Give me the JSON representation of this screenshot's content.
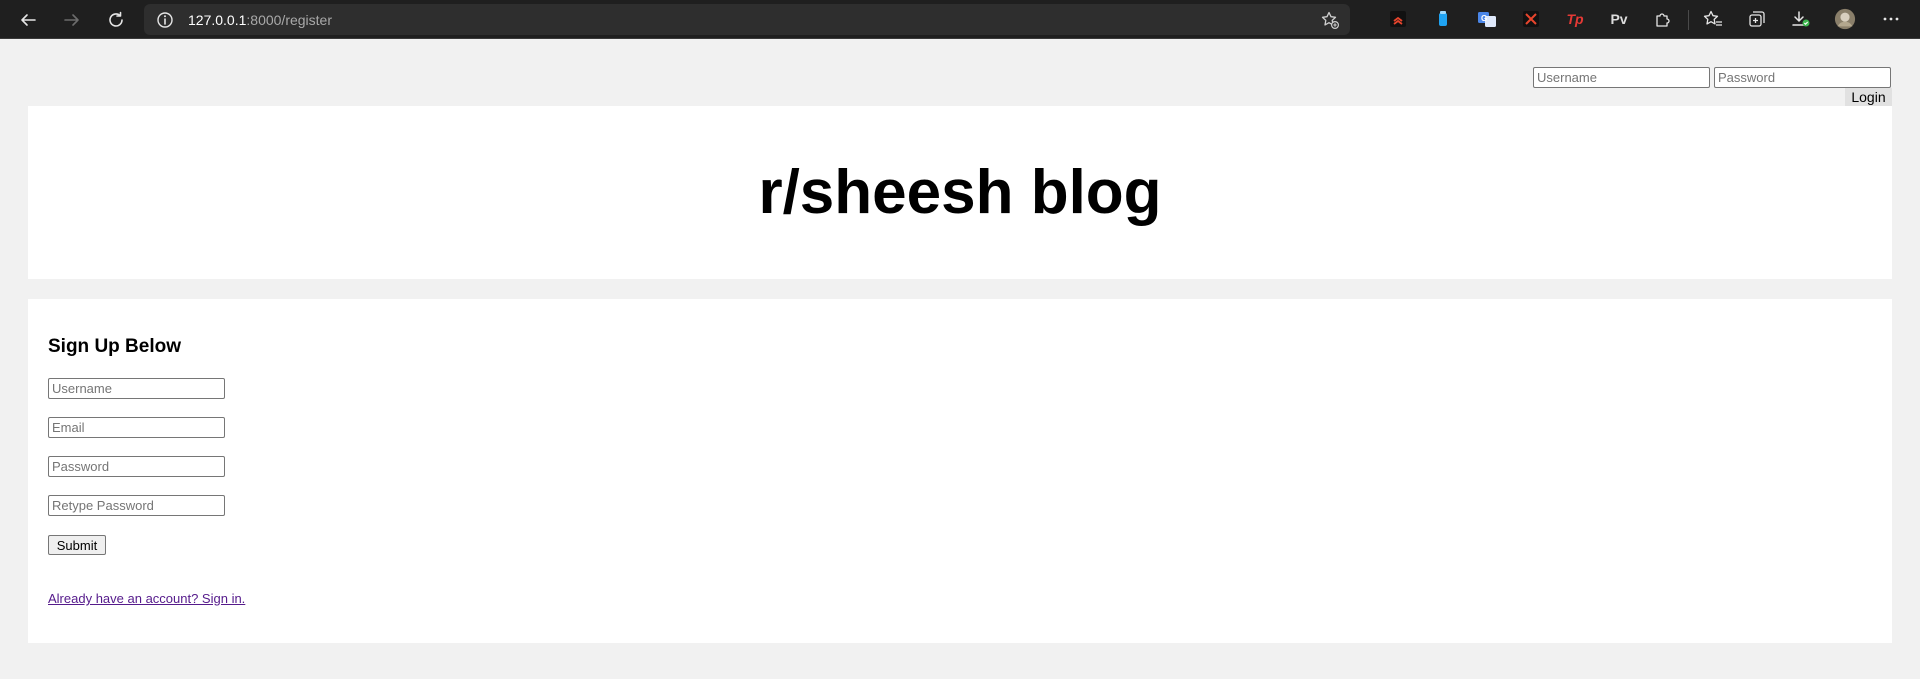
{
  "browser": {
    "url_host": "127.0.0.1",
    "url_path": ":8000/register",
    "colors": {
      "toolbar": "#1f1f1f",
      "addressbar": "#2e2e2e"
    },
    "extensions": [
      {
        "name": "ext-red-chevrons-icon",
        "label": "",
        "color": "#e8452c"
      },
      {
        "name": "ext-blue-cup-icon",
        "label": "",
        "color": "#1fa3f2"
      },
      {
        "name": "ext-translate-icon",
        "label": "",
        "color": "#4a86e8"
      },
      {
        "name": "ext-red-x-icon",
        "label": "",
        "color": "#e8452c"
      },
      {
        "name": "ext-tp-icon",
        "label": "Tp",
        "color": "#e53935"
      },
      {
        "name": "ext-pv-icon",
        "label": "Pv",
        "color": "#dcdcdc"
      }
    ]
  },
  "login": {
    "username_placeholder": "Username",
    "password_placeholder": "Password",
    "button_label": "Login"
  },
  "header": {
    "title": "r/sheesh blog"
  },
  "register": {
    "heading": "Sign Up Below",
    "fields": [
      {
        "placeholder": "Username"
      },
      {
        "placeholder": "Email"
      },
      {
        "placeholder": "Password"
      },
      {
        "placeholder": "Retype Password"
      }
    ],
    "submit_label": "Submit",
    "signin_link": "Already have an account? Sign in."
  }
}
